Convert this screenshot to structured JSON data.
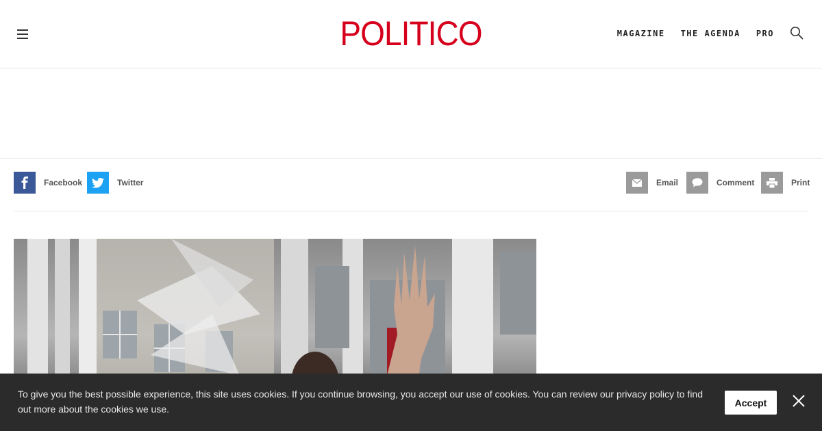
{
  "header": {
    "logo": "POLITICO",
    "nav": [
      "MAGAZINE",
      "THE AGENDA",
      "PRO"
    ]
  },
  "share": {
    "facebook": "Facebook",
    "twitter": "Twitter",
    "email": "Email",
    "comment": "Comment",
    "print": "Print"
  },
  "icons": {
    "menu": "hamburger-icon",
    "search": "search-icon",
    "facebook": "facebook-icon",
    "twitter": "twitter-icon",
    "email": "envelope-icon",
    "comment": "speech-bubble-icon",
    "print": "printer-icon",
    "close": "close-icon"
  },
  "colors": {
    "brand": "#d6001c",
    "facebook": "#3b5998",
    "twitter": "#1da1f2",
    "share_gray": "#9a9a9a",
    "cookie_bg": "#2b2b2b"
  },
  "cookie": {
    "text": "To give you the best possible experience, this site uses cookies. If you continue browsing, you accept our use of cookies. You can review our privacy policy to find out more about the cookies we use.",
    "accept": "Accept"
  }
}
